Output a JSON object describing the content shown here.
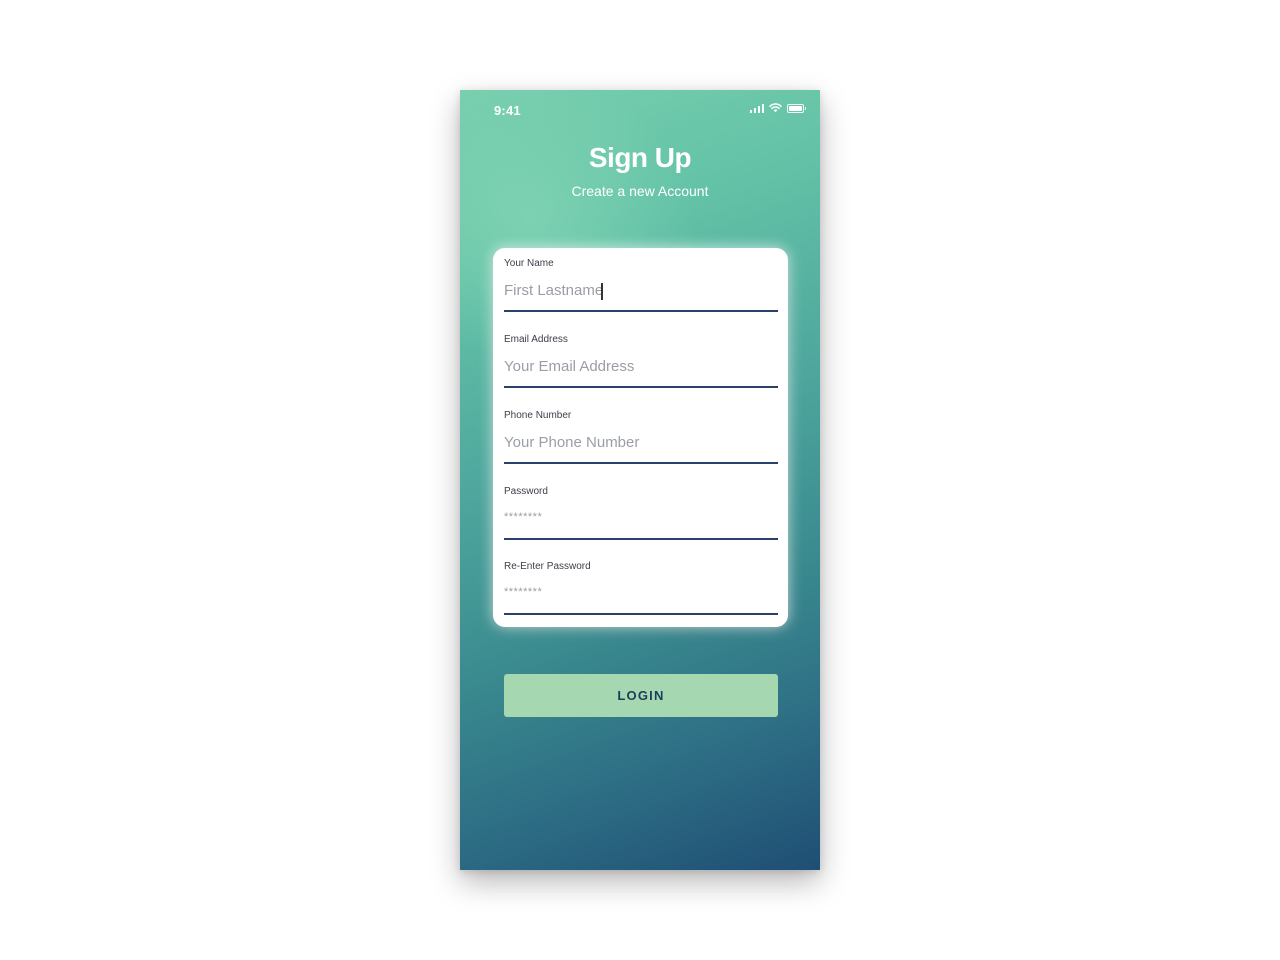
{
  "status_bar": {
    "time": "9:41",
    "icons": [
      "signal-icon",
      "wifi-icon",
      "battery-icon"
    ]
  },
  "header": {
    "title": "Sign Up",
    "subtitle": "Create a new Account"
  },
  "form": {
    "fields": [
      {
        "label": "Your Name",
        "value": "First Lastname",
        "placeholder": "",
        "focused": true
      },
      {
        "label": "Email Address",
        "value": "",
        "placeholder": "Your Email Address"
      },
      {
        "label": "Phone Number",
        "value": "",
        "placeholder": "Your Phone Number"
      },
      {
        "label": "Password",
        "value": "",
        "placeholder": "********"
      },
      {
        "label": "Re-Enter Password",
        "value": "",
        "placeholder": "********"
      }
    ]
  },
  "actions": {
    "login_label": "LOGIN"
  },
  "colors": {
    "gradient_start": "#78cfae",
    "gradient_end": "#1f4e74",
    "button_bg": "#a5d8b0",
    "button_text": "#1c3d5c",
    "field_underline": "#28406b"
  }
}
